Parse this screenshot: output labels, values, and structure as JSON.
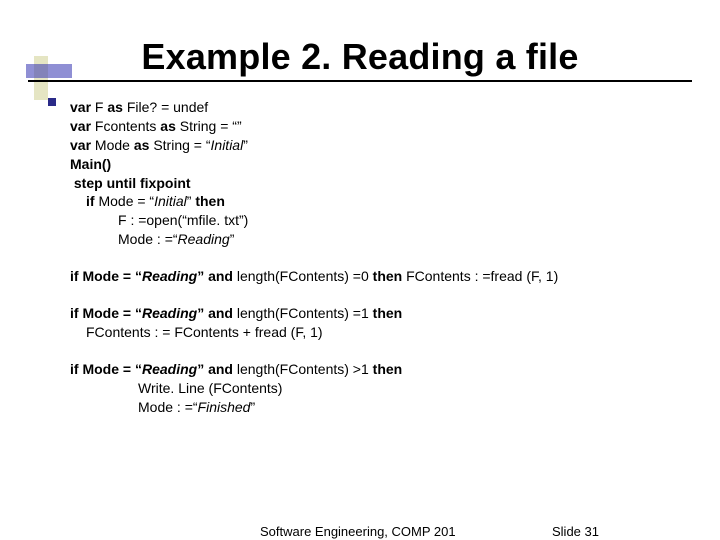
{
  "title": "Example 2.  Reading a file",
  "lines": {
    "l1a": "var ",
    "l1b": "F ",
    "l1c": "as ",
    "l1d": "File? = undef",
    "l2a": "var ",
    "l2b": "Fcontents ",
    "l2c": "as ",
    "l2d": "String = “”",
    "l3a": "var ",
    "l3b": "Mode ",
    "l3c": "as ",
    "l3d": "String = “",
    "l3e": "Initial",
    "l3f": "”",
    "l4": "Main()",
    "l5": " step until fixpoint",
    "l6a": "if ",
    "l6b": "Mode = “",
    "l6c": "Initial",
    "l6d": "” ",
    "l6e": "then",
    "l7": "F : =open(“mfile. txt”)",
    "l8a": "Mode : =“",
    "l8b": "Reading",
    "l8c": "”",
    "b2a": "if Mode = “",
    "b2b": "Reading",
    "b2c": "” and ",
    "b2d": "length(FContents) =0 ",
    "b2e": "then ",
    "b2f": "FContents : =fread (F, 1)",
    "b3a": "if Mode = “",
    "b3b": "Reading",
    "b3c": "” and ",
    "b3d": "length(FContents) =1 ",
    "b3e": "then",
    "b3f": "FContents : = FContents + fread (F, 1)",
    "b4a": "if Mode = “",
    "b4b": "Reading",
    "b4c": "” and ",
    "b4d": "length(FContents) >1 ",
    "b4e": "then",
    "b4f": "Write. Line (FContents)",
    "b4g": "Mode : =“",
    "b4h": "Finished",
    "b4i": "”"
  },
  "footer": {
    "course": "Software Engineering, COMP 201",
    "page_label": "Slide ",
    "page_num": "31"
  }
}
